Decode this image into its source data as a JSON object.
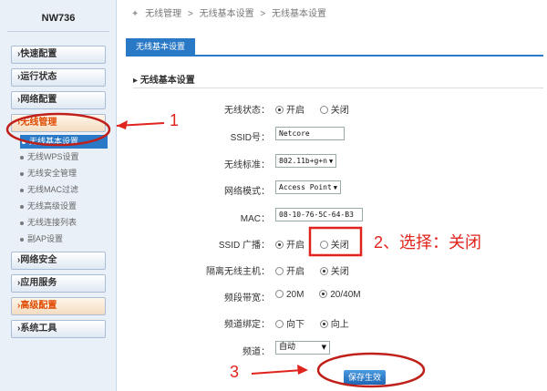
{
  "brand": "NW736",
  "breadcrumb": [
    "无线管理",
    ">",
    "无线基本设置",
    ">",
    "无线基本设置"
  ],
  "sidebar": {
    "top_items": [
      {
        "label": "›快速配置"
      },
      {
        "label": "›运行状态"
      },
      {
        "label": "›网络配置"
      },
      {
        "label": "›无线管理"
      }
    ],
    "sub_items": [
      {
        "label": "无线基本设置"
      },
      {
        "label": "无线WPS设置"
      },
      {
        "label": "无线安全管理"
      },
      {
        "label": "无线MAC过滤"
      },
      {
        "label": "无线高级设置"
      },
      {
        "label": "无线连接列表"
      },
      {
        "label": "副AP设置"
      }
    ],
    "bottom_items": [
      {
        "label": "›网络安全"
      },
      {
        "label": "›应用服务"
      },
      {
        "label": "›高级配置"
      },
      {
        "label": "›系统工具"
      }
    ]
  },
  "tab": "无线基本设置",
  "section_title": "无线基本设置",
  "form": {
    "wireless_status": {
      "label": "无线状态：",
      "options": [
        "开启",
        "关闭"
      ]
    },
    "ssid": {
      "label": "SSID号：",
      "value": "Netcore"
    },
    "standard": {
      "label": "无线标准：",
      "value": "802.11b+g+n"
    },
    "mode": {
      "label": "网络模式：",
      "value": "Access Point"
    },
    "mac": {
      "label": "MAC：",
      "value": "08-10-76-5C-64-B3"
    },
    "ssid_broadcast": {
      "label": "SSID 广播：",
      "options": [
        "开启",
        "关闭"
      ]
    },
    "isolate": {
      "label": "隔离无线主机：",
      "options": [
        "开启",
        "关闭"
      ]
    },
    "bandwidth": {
      "label": "频段带宽：",
      "options": [
        "20M",
        "20/40M"
      ]
    },
    "channel_bind": {
      "label": "频道绑定：",
      "options": [
        "向下",
        "向上"
      ]
    },
    "channel": {
      "label": "频道：",
      "value": "自动"
    }
  },
  "save_label": "保存生效",
  "annotations": {
    "step1": "1",
    "step2": "2、选择：关闭",
    "step3": "3"
  },
  "colors": {
    "accent": "#2a79c7",
    "annotation": "#e0231c",
    "active_menu": "#e04a00"
  }
}
